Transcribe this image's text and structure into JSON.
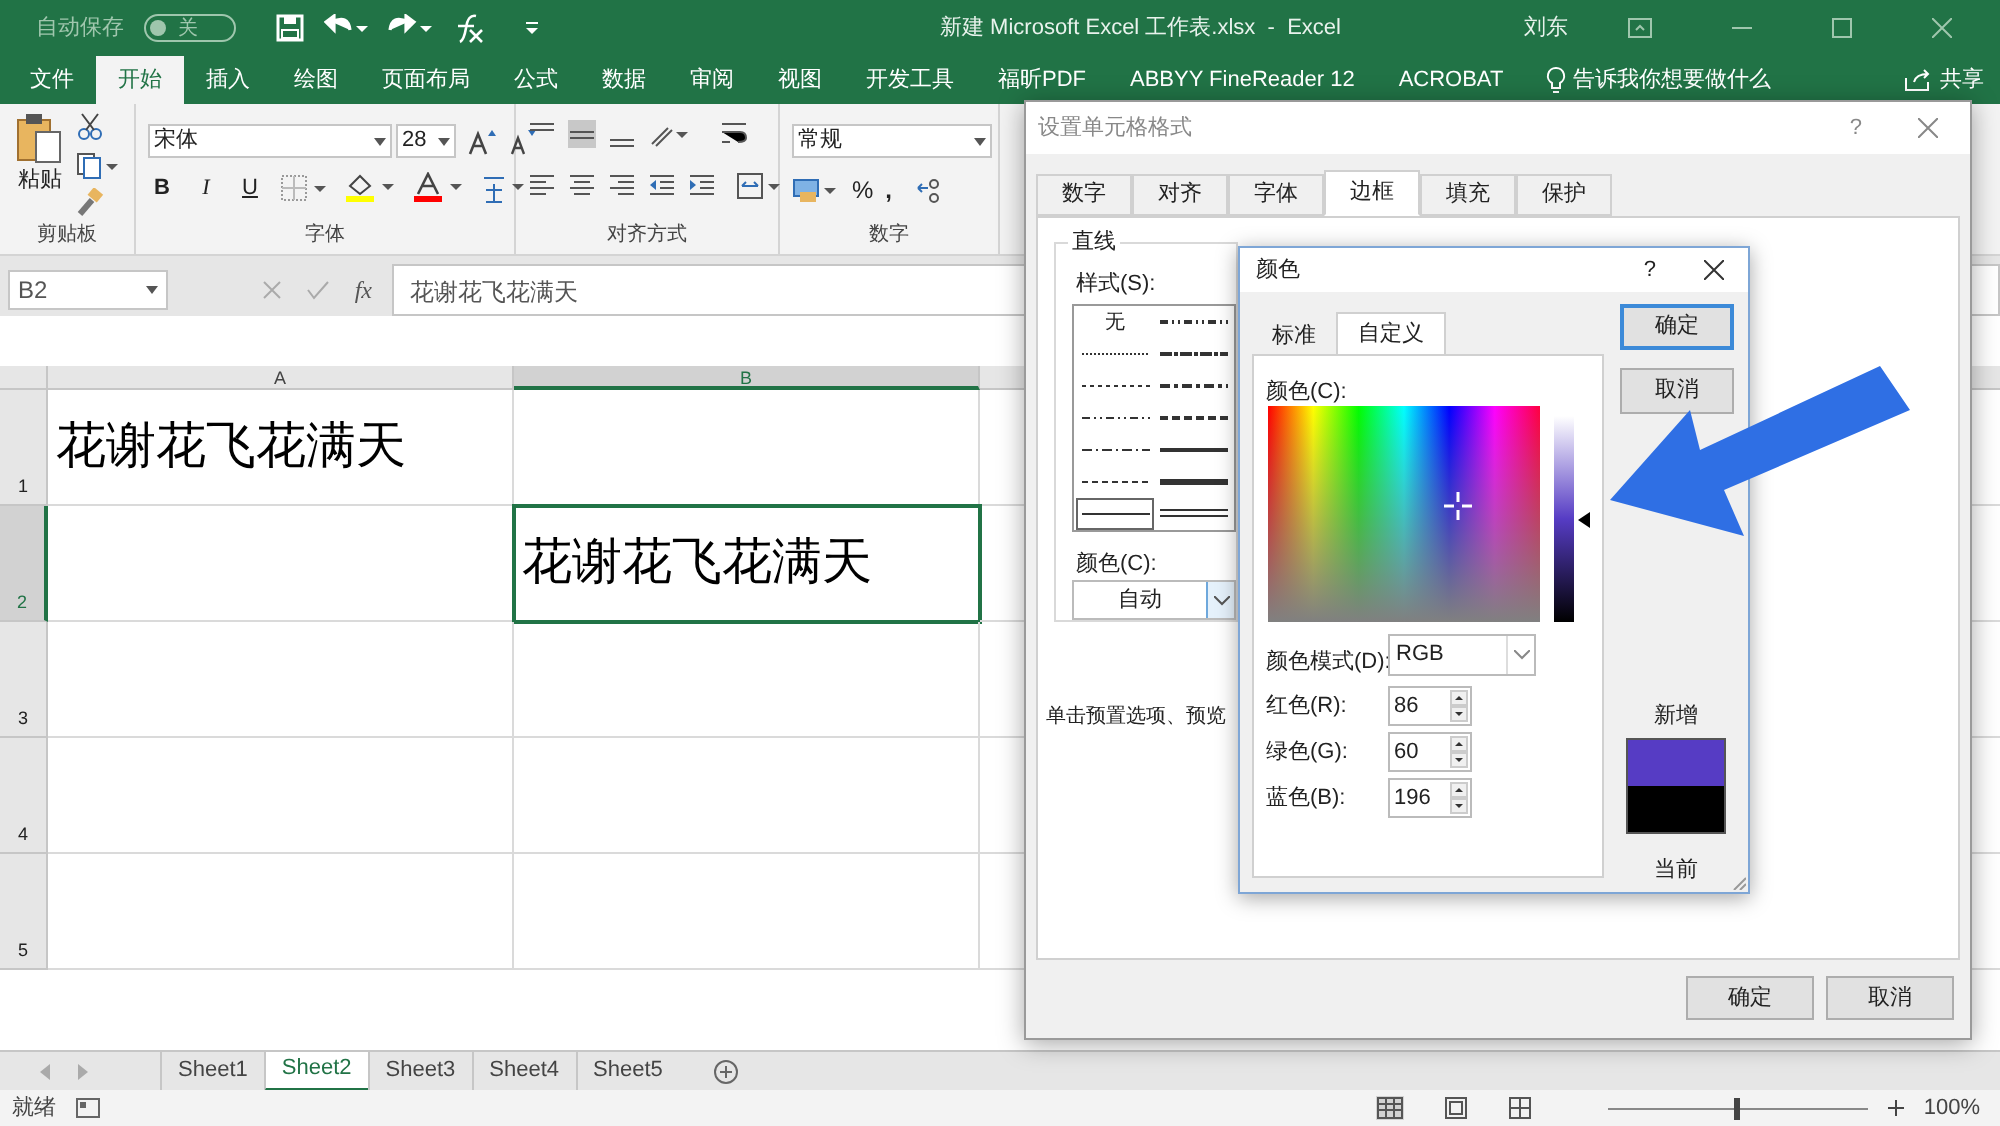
{
  "title_bar": {
    "autosave_label": "自动保存",
    "autosave": {
      "on": false,
      "label": "关"
    },
    "title": "新建 Microsoft Excel 工作表.xlsx  -  Excel",
    "user": "刘东"
  },
  "menu_tabs": [
    {
      "label": "文件",
      "selected": false
    },
    {
      "label": "开始",
      "selected": true
    },
    {
      "label": "插入",
      "selected": false
    },
    {
      "label": "绘图",
      "selected": false
    },
    {
      "label": "页面布局",
      "selected": false
    },
    {
      "label": "公式",
      "selected": false
    },
    {
      "label": "数据",
      "selected": false
    },
    {
      "label": "审阅",
      "selected": false
    },
    {
      "label": "视图",
      "selected": false
    },
    {
      "label": "开发工具",
      "selected": false
    },
    {
      "label": "福昕PDF",
      "selected": false
    },
    {
      "label": "ABBYY FineReader 12",
      "selected": false
    },
    {
      "label": "ACROBAT",
      "selected": false
    }
  ],
  "tell_me": "告诉我你想要做什么",
  "share": "共享",
  "ribbon": {
    "paste": "粘贴",
    "font": "宋体",
    "size": "28",
    "bold": "B",
    "italic": "I",
    "underline": "U",
    "number_format": "常规",
    "percent": "%",
    "comma": ",",
    "groups": [
      "剪贴板",
      "字体",
      "对齐方式",
      "数字"
    ]
  },
  "formula_bar": {
    "name_box": "B2",
    "fx": "fx",
    "value": "花谢花飞花满天"
  },
  "sheet": {
    "columns": [
      "A",
      "B"
    ],
    "rows": [
      {
        "number": "1",
        "cells": [
          "花谢花飞花满天",
          ""
        ]
      },
      {
        "number": "2",
        "cells": [
          "",
          "花谢花飞花满天"
        ]
      },
      {
        "number": "3",
        "cells": [
          "",
          ""
        ]
      },
      {
        "number": "4",
        "cells": [
          "",
          ""
        ]
      },
      {
        "number": "5",
        "cells": [
          "",
          ""
        ]
      }
    ]
  },
  "sheet_tabs": [
    {
      "label": "Sheet1",
      "selected": false
    },
    {
      "label": "Sheet2",
      "selected": true
    },
    {
      "label": "Sheet3",
      "selected": false
    },
    {
      "label": "Sheet4",
      "selected": false
    },
    {
      "label": "Sheet5",
      "selected": false
    }
  ],
  "status_bar": {
    "status": "就绪",
    "zoom_slider": {
      "level": 0.5
    },
    "zoom": "100%"
  },
  "format_dialog": {
    "title": "设置单元格格式",
    "help": "?",
    "tabs": [
      {
        "label": "数字",
        "selected": false
      },
      {
        "label": "对齐",
        "selected": false
      },
      {
        "label": "字体",
        "selected": false
      },
      {
        "label": "边框",
        "selected": true
      },
      {
        "label": "填充",
        "selected": false
      },
      {
        "label": "保护",
        "selected": false
      }
    ],
    "line_group": "直线",
    "style_label": "样式(S):",
    "line_styles": [
      {
        "kind": "none",
        "label": "无",
        "selected": false
      },
      {
        "kind": "dashdotdot",
        "selected": false
      },
      {
        "kind": "hair",
        "selected": false
      },
      {
        "kind": "slant",
        "selected": false
      },
      {
        "kind": "dotted",
        "selected": false
      },
      {
        "kind": "dashdot_medium",
        "selected": false
      },
      {
        "kind": "dashdotdot_thin",
        "selected": false
      },
      {
        "kind": "dashed_medium",
        "selected": false
      },
      {
        "kind": "dashdot",
        "selected": false
      },
      {
        "kind": "medium",
        "selected": false
      },
      {
        "kind": "dashed",
        "selected": false
      },
      {
        "kind": "thick",
        "selected": false
      },
      {
        "kind": "thin",
        "selected": true
      },
      {
        "kind": "double",
        "selected": false
      }
    ],
    "color_label": "颜色(C):",
    "color_value": "自动",
    "hint": "单击预置选项、预览",
    "ok": "确定",
    "cancel": "取消"
  },
  "color_dialog": {
    "title": "颜色",
    "help": "?",
    "tabs": [
      {
        "label": "标准",
        "selected": false
      },
      {
        "label": "自定义",
        "selected": true
      }
    ],
    "colors_label": "颜色(C):",
    "luminance": {
      "level": 0.5
    },
    "mode_label": "颜色模式(D):",
    "mode": "RGB",
    "channels": [
      {
        "label": "红色(R):",
        "value": "86"
      },
      {
        "label": "绿色(G):",
        "value": "60"
      },
      {
        "label": "蓝色(B):",
        "value": "196"
      }
    ],
    "ok": "确定",
    "cancel": "取消",
    "new_label": "新增",
    "current_label": "当前"
  }
}
